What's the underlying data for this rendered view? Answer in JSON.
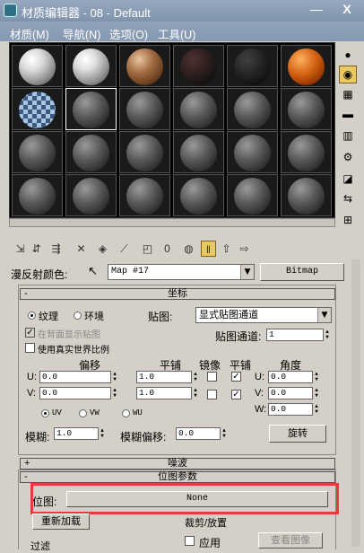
{
  "window": {
    "title": "材质编辑器 - 08 - Default",
    "minimize": "—",
    "close": "X"
  },
  "menu": {
    "items": [
      "材质(M)",
      "导航(N)",
      "选项(O)",
      "工具(U)"
    ]
  },
  "slots": {
    "materials": [
      "white",
      "white",
      "copper",
      "noise",
      "noise2",
      "orange",
      "checker",
      "gray",
      "gray",
      "gray",
      "gray",
      "gray",
      "gray",
      "gray",
      "gray",
      "gray",
      "gray",
      "gray",
      "gray",
      "gray",
      "gray",
      "gray",
      "gray",
      "gray"
    ]
  },
  "diffuse_row": {
    "label": "漫反射颜色:",
    "map_name": "Map #17",
    "map_type": "Bitmap"
  },
  "coordinates": {
    "header": "坐标",
    "texture_label": "纹理",
    "environ_label": "环境",
    "mapping_label": "贴图:",
    "mapping_value": "显式贴图通道",
    "map_channel_label": "贴图通道:",
    "map_channel_value": "1",
    "show_back_label": "在背面显示贴图",
    "real_world_label": "使用真实世界比例",
    "offset_label": "偏移",
    "tiling_label": "平铺",
    "mirror_label": "镜像",
    "tile_label": "平铺",
    "angle_label": "角度",
    "u_label": "U:",
    "v_label": "V:",
    "w_label": "W:",
    "u_offset": "0.0",
    "v_offset": "0.0",
    "u_tiling": "1.0",
    "v_tiling": "1.0",
    "u_angle": "0.0",
    "v_angle": "0.0",
    "w_angle": "0.0",
    "uv_label": "UV",
    "vw_label": "VW",
    "wu_label": "WU",
    "blur_label": "模糊:",
    "blur_value": "1.0",
    "blur_offset_label": "模糊偏移:",
    "blur_offset_value": "0.0",
    "rotate_button": "旋转"
  },
  "noise": {
    "header": "噪波",
    "sign": "+"
  },
  "bitmap_params": {
    "header": "位图参数",
    "bitmap_label": "位图:",
    "bitmap_value": "None",
    "reload_button": "重新加载",
    "crop_label": "裁剪/放置",
    "apply_label": "应用",
    "view_image_button": "查看图像",
    "filter_label": "过滤"
  }
}
